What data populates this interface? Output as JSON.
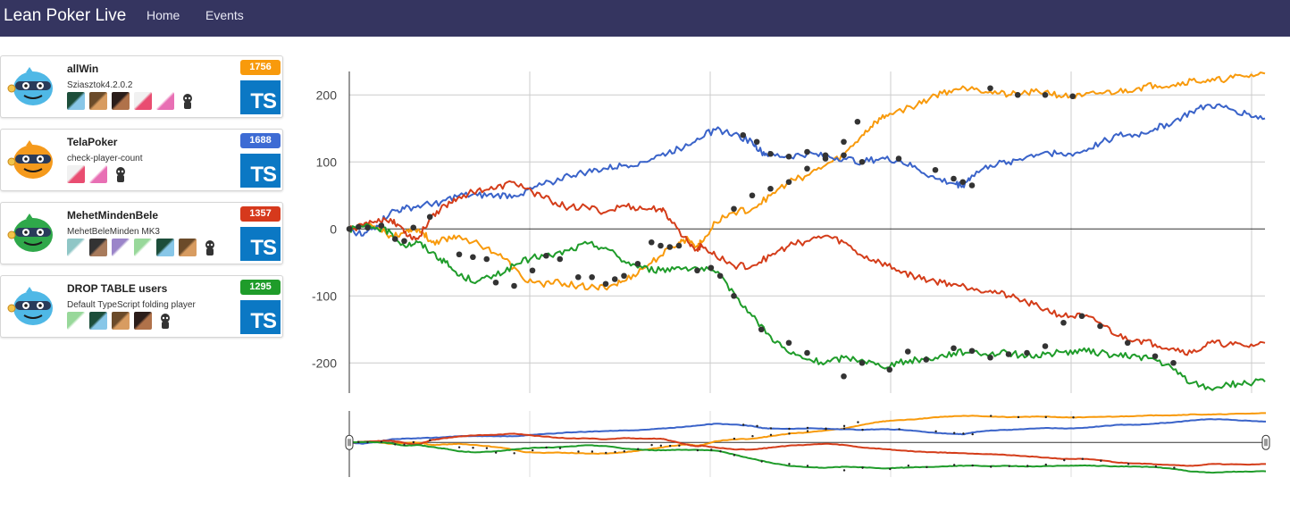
{
  "nav": {
    "brand": "Lean Poker Live",
    "links": [
      "Home",
      "Events"
    ]
  },
  "teams": [
    {
      "name": "allWin",
      "description": "Sziasztok4.2.0.2",
      "score": "1756",
      "badge_color": "#f89a0c",
      "mascot_color": "#4fb8e6",
      "language": "TS",
      "avatar_count": 6
    },
    {
      "name": "TelaPoker",
      "description": "check-player-count",
      "score": "1688",
      "badge_color": "#3d6bd4",
      "mascot_color": "#f59a1c",
      "language": "TS",
      "avatar_count": 3
    },
    {
      "name": "MehetMindenBele",
      "description": "MehetBeleMinden MK3",
      "score": "1357",
      "badge_color": "#d6391c",
      "mascot_color": "#2fa84a",
      "language": "TS",
      "avatar_count": 7
    },
    {
      "name": "DROP TABLE users",
      "description": "Default TypeScript folding player",
      "score": "1295",
      "badge_color": "#1f9c2a",
      "mascot_color": "#4fb8e6",
      "language": "TS",
      "avatar_count": 5
    }
  ],
  "chart_data": {
    "type": "line",
    "yticks": [
      200,
      100,
      0,
      -100,
      -200
    ],
    "ylim": [
      -245,
      235
    ],
    "xlim": [
      0,
      1000
    ],
    "grid": true,
    "legend": "none",
    "series": [
      {
        "color": "#f89a0c",
        "points": [
          [
            0,
            0
          ],
          [
            15,
            5
          ],
          [
            30,
            2
          ],
          [
            45,
            -10
          ],
          [
            60,
            -5
          ],
          [
            70,
            2
          ],
          [
            80,
            -5
          ],
          [
            90,
            -20
          ],
          [
            105,
            -15
          ],
          [
            120,
            -10
          ],
          [
            150,
            -28
          ],
          [
            170,
            -45
          ],
          [
            190,
            -75
          ],
          [
            210,
            -82
          ],
          [
            230,
            -80
          ],
          [
            250,
            -85
          ],
          [
            270,
            -89
          ],
          [
            285,
            -85
          ],
          [
            300,
            -78
          ],
          [
            320,
            -60
          ],
          [
            340,
            -40
          ],
          [
            360,
            -20
          ],
          [
            370,
            -15
          ],
          [
            380,
            -25
          ],
          [
            385,
            -20
          ],
          [
            400,
            10
          ],
          [
            420,
            25
          ],
          [
            440,
            30
          ],
          [
            460,
            50
          ],
          [
            480,
            70
          ],
          [
            500,
            80
          ],
          [
            520,
            95
          ],
          [
            540,
            110
          ],
          [
            560,
            140
          ],
          [
            575,
            160
          ],
          [
            590,
            172
          ],
          [
            620,
            185
          ],
          [
            640,
            200
          ],
          [
            660,
            208
          ],
          [
            680,
            212
          ],
          [
            700,
            205
          ],
          [
            720,
            200
          ],
          [
            740,
            203
          ],
          [
            760,
            205
          ],
          [
            780,
            198
          ],
          [
            800,
            198
          ],
          [
            820,
            203
          ],
          [
            840,
            205
          ],
          [
            860,
            210
          ],
          [
            880,
            215
          ],
          [
            900,
            215
          ],
          [
            920,
            222
          ],
          [
            940,
            220
          ],
          [
            960,
            225
          ],
          [
            980,
            228
          ],
          [
            1000,
            232
          ]
        ]
      },
      {
        "color": "#3a63c9",
        "points": [
          [
            0,
            0
          ],
          [
            15,
            -10
          ],
          [
            30,
            5
          ],
          [
            45,
            25
          ],
          [
            60,
            30
          ],
          [
            80,
            35
          ],
          [
            100,
            40
          ],
          [
            120,
            50
          ],
          [
            140,
            50
          ],
          [
            160,
            50
          ],
          [
            180,
            50
          ],
          [
            200,
            60
          ],
          [
            220,
            70
          ],
          [
            240,
            80
          ],
          [
            260,
            85
          ],
          [
            280,
            90
          ],
          [
            300,
            95
          ],
          [
            320,
            100
          ],
          [
            340,
            110
          ],
          [
            360,
            120
          ],
          [
            380,
            135
          ],
          [
            400,
            148
          ],
          [
            420,
            142
          ],
          [
            440,
            130
          ],
          [
            450,
            115
          ],
          [
            460,
            110
          ],
          [
            480,
            108
          ],
          [
            500,
            112
          ],
          [
            520,
            108
          ],
          [
            540,
            105
          ],
          [
            560,
            100
          ],
          [
            580,
            105
          ],
          [
            600,
            102
          ],
          [
            620,
            90
          ],
          [
            640,
            75
          ],
          [
            660,
            68
          ],
          [
            670,
            65
          ],
          [
            680,
            80
          ],
          [
            700,
            95
          ],
          [
            720,
            100
          ],
          [
            740,
            108
          ],
          [
            760,
            115
          ],
          [
            780,
            110
          ],
          [
            800,
            115
          ],
          [
            820,
            128
          ],
          [
            840,
            140
          ],
          [
            860,
            140
          ],
          [
            880,
            150
          ],
          [
            900,
            160
          ],
          [
            920,
            175
          ],
          [
            940,
            185
          ],
          [
            960,
            180
          ],
          [
            980,
            172
          ],
          [
            1000,
            165
          ]
        ]
      },
      {
        "color": "#d43d1a",
        "points": [
          [
            0,
            0
          ],
          [
            15,
            5
          ],
          [
            30,
            10
          ],
          [
            45,
            15
          ],
          [
            55,
            5
          ],
          [
            65,
            -10
          ],
          [
            75,
            -15
          ],
          [
            90,
            20
          ],
          [
            105,
            35
          ],
          [
            120,
            48
          ],
          [
            140,
            58
          ],
          [
            160,
            60
          ],
          [
            180,
            70
          ],
          [
            200,
            55
          ],
          [
            220,
            42
          ],
          [
            240,
            32
          ],
          [
            260,
            32
          ],
          [
            280,
            25
          ],
          [
            300,
            35
          ],
          [
            320,
            30
          ],
          [
            340,
            30
          ],
          [
            350,
            15
          ],
          [
            370,
            -20
          ],
          [
            380,
            -30
          ],
          [
            385,
            -25
          ],
          [
            400,
            -40
          ],
          [
            420,
            -55
          ],
          [
            440,
            -55
          ],
          [
            460,
            -40
          ],
          [
            480,
            -25
          ],
          [
            500,
            -18
          ],
          [
            520,
            -10
          ],
          [
            540,
            -20
          ],
          [
            560,
            -40
          ],
          [
            580,
            -50
          ],
          [
            600,
            -62
          ],
          [
            620,
            -72
          ],
          [
            640,
            -78
          ],
          [
            660,
            -82
          ],
          [
            680,
            -88
          ],
          [
            700,
            -92
          ],
          [
            720,
            -100
          ],
          [
            740,
            -110
          ],
          [
            760,
            -120
          ],
          [
            780,
            -130
          ],
          [
            800,
            -130
          ],
          [
            820,
            -140
          ],
          [
            840,
            -160
          ],
          [
            860,
            -165
          ],
          [
            880,
            -172
          ],
          [
            900,
            -178
          ],
          [
            920,
            -185
          ],
          [
            940,
            -170
          ],
          [
            960,
            -172
          ],
          [
            980,
            -175
          ],
          [
            1000,
            -170
          ]
        ]
      },
      {
        "color": "#1f9c2a",
        "points": [
          [
            0,
            0
          ],
          [
            15,
            3
          ],
          [
            30,
            2
          ],
          [
            45,
            -5
          ],
          [
            60,
            -25
          ],
          [
            75,
            -20
          ],
          [
            90,
            -35
          ],
          [
            105,
            -50
          ],
          [
            120,
            -70
          ],
          [
            140,
            -78
          ],
          [
            160,
            -70
          ],
          [
            180,
            -55
          ],
          [
            200,
            -42
          ],
          [
            220,
            -40
          ],
          [
            240,
            -32
          ],
          [
            260,
            -22
          ],
          [
            280,
            -28
          ],
          [
            300,
            -48
          ],
          [
            320,
            -58
          ],
          [
            340,
            -62
          ],
          [
            360,
            -57
          ],
          [
            380,
            -58
          ],
          [
            400,
            -65
          ],
          [
            420,
            -95
          ],
          [
            440,
            -130
          ],
          [
            460,
            -160
          ],
          [
            480,
            -185
          ],
          [
            500,
            -195
          ],
          [
            520,
            -200
          ],
          [
            540,
            -192
          ],
          [
            560,
            -195
          ],
          [
            580,
            -205
          ],
          [
            600,
            -200
          ],
          [
            620,
            -195
          ],
          [
            640,
            -192
          ],
          [
            660,
            -185
          ],
          [
            680,
            -182
          ],
          [
            700,
            -187
          ],
          [
            720,
            -185
          ],
          [
            740,
            -190
          ],
          [
            760,
            -187
          ],
          [
            780,
            -184
          ],
          [
            800,
            -182
          ],
          [
            820,
            -185
          ],
          [
            840,
            -190
          ],
          [
            860,
            -190
          ],
          [
            880,
            -195
          ],
          [
            900,
            -210
          ],
          [
            920,
            -230
          ],
          [
            940,
            -238
          ],
          [
            960,
            -232
          ],
          [
            980,
            -230
          ],
          [
            1000,
            -228
          ]
        ]
      }
    ],
    "markers": [
      [
        0,
        0
      ],
      [
        10,
        3
      ],
      [
        20,
        2
      ],
      [
        35,
        5
      ],
      [
        50,
        -15
      ],
      [
        60,
        -18
      ],
      [
        70,
        2
      ],
      [
        88,
        18
      ],
      [
        120,
        -38
      ],
      [
        135,
        -42
      ],
      [
        150,
        -45
      ],
      [
        160,
        -80
      ],
      [
        180,
        -85
      ],
      [
        200,
        -62
      ],
      [
        215,
        -40
      ],
      [
        230,
        -45
      ],
      [
        250,
        -72
      ],
      [
        265,
        -72
      ],
      [
        280,
        -82
      ],
      [
        290,
        -75
      ],
      [
        300,
        -70
      ],
      [
        315,
        -52
      ],
      [
        330,
        -20
      ],
      [
        340,
        -25
      ],
      [
        350,
        -27
      ],
      [
        360,
        -25
      ],
      [
        380,
        -62
      ],
      [
        395,
        -58
      ],
      [
        405,
        -70
      ],
      [
        420,
        -100
      ],
      [
        450,
        -150
      ],
      [
        480,
        -170
      ],
      [
        500,
        -185
      ],
      [
        540,
        -220
      ],
      [
        560,
        -200
      ],
      [
        590,
        -210
      ],
      [
        610,
        -183
      ],
      [
        630,
        -195
      ],
      [
        660,
        -178
      ],
      [
        680,
        -182
      ],
      [
        700,
        -192
      ],
      [
        720,
        -187
      ],
      [
        740,
        -185
      ],
      [
        760,
        -175
      ],
      [
        780,
        -140
      ],
      [
        800,
        -130
      ],
      [
        820,
        -145
      ],
      [
        850,
        -170
      ],
      [
        880,
        -190
      ],
      [
        900,
        -200
      ],
      [
        430,
        140
      ],
      [
        445,
        130
      ],
      [
        460,
        112
      ],
      [
        480,
        108
      ],
      [
        500,
        115
      ],
      [
        520,
        105
      ],
      [
        540,
        110
      ],
      [
        560,
        100
      ],
      [
        600,
        105
      ],
      [
        640,
        88
      ],
      [
        660,
        75
      ],
      [
        670,
        70
      ],
      [
        680,
        65
      ],
      [
        700,
        210
      ],
      [
        730,
        200
      ],
      [
        760,
        200
      ],
      [
        790,
        198
      ],
      [
        420,
        30
      ],
      [
        440,
        50
      ],
      [
        460,
        60
      ],
      [
        480,
        70
      ],
      [
        500,
        90
      ],
      [
        520,
        110
      ],
      [
        540,
        130
      ],
      [
        555,
        160
      ]
    ]
  }
}
